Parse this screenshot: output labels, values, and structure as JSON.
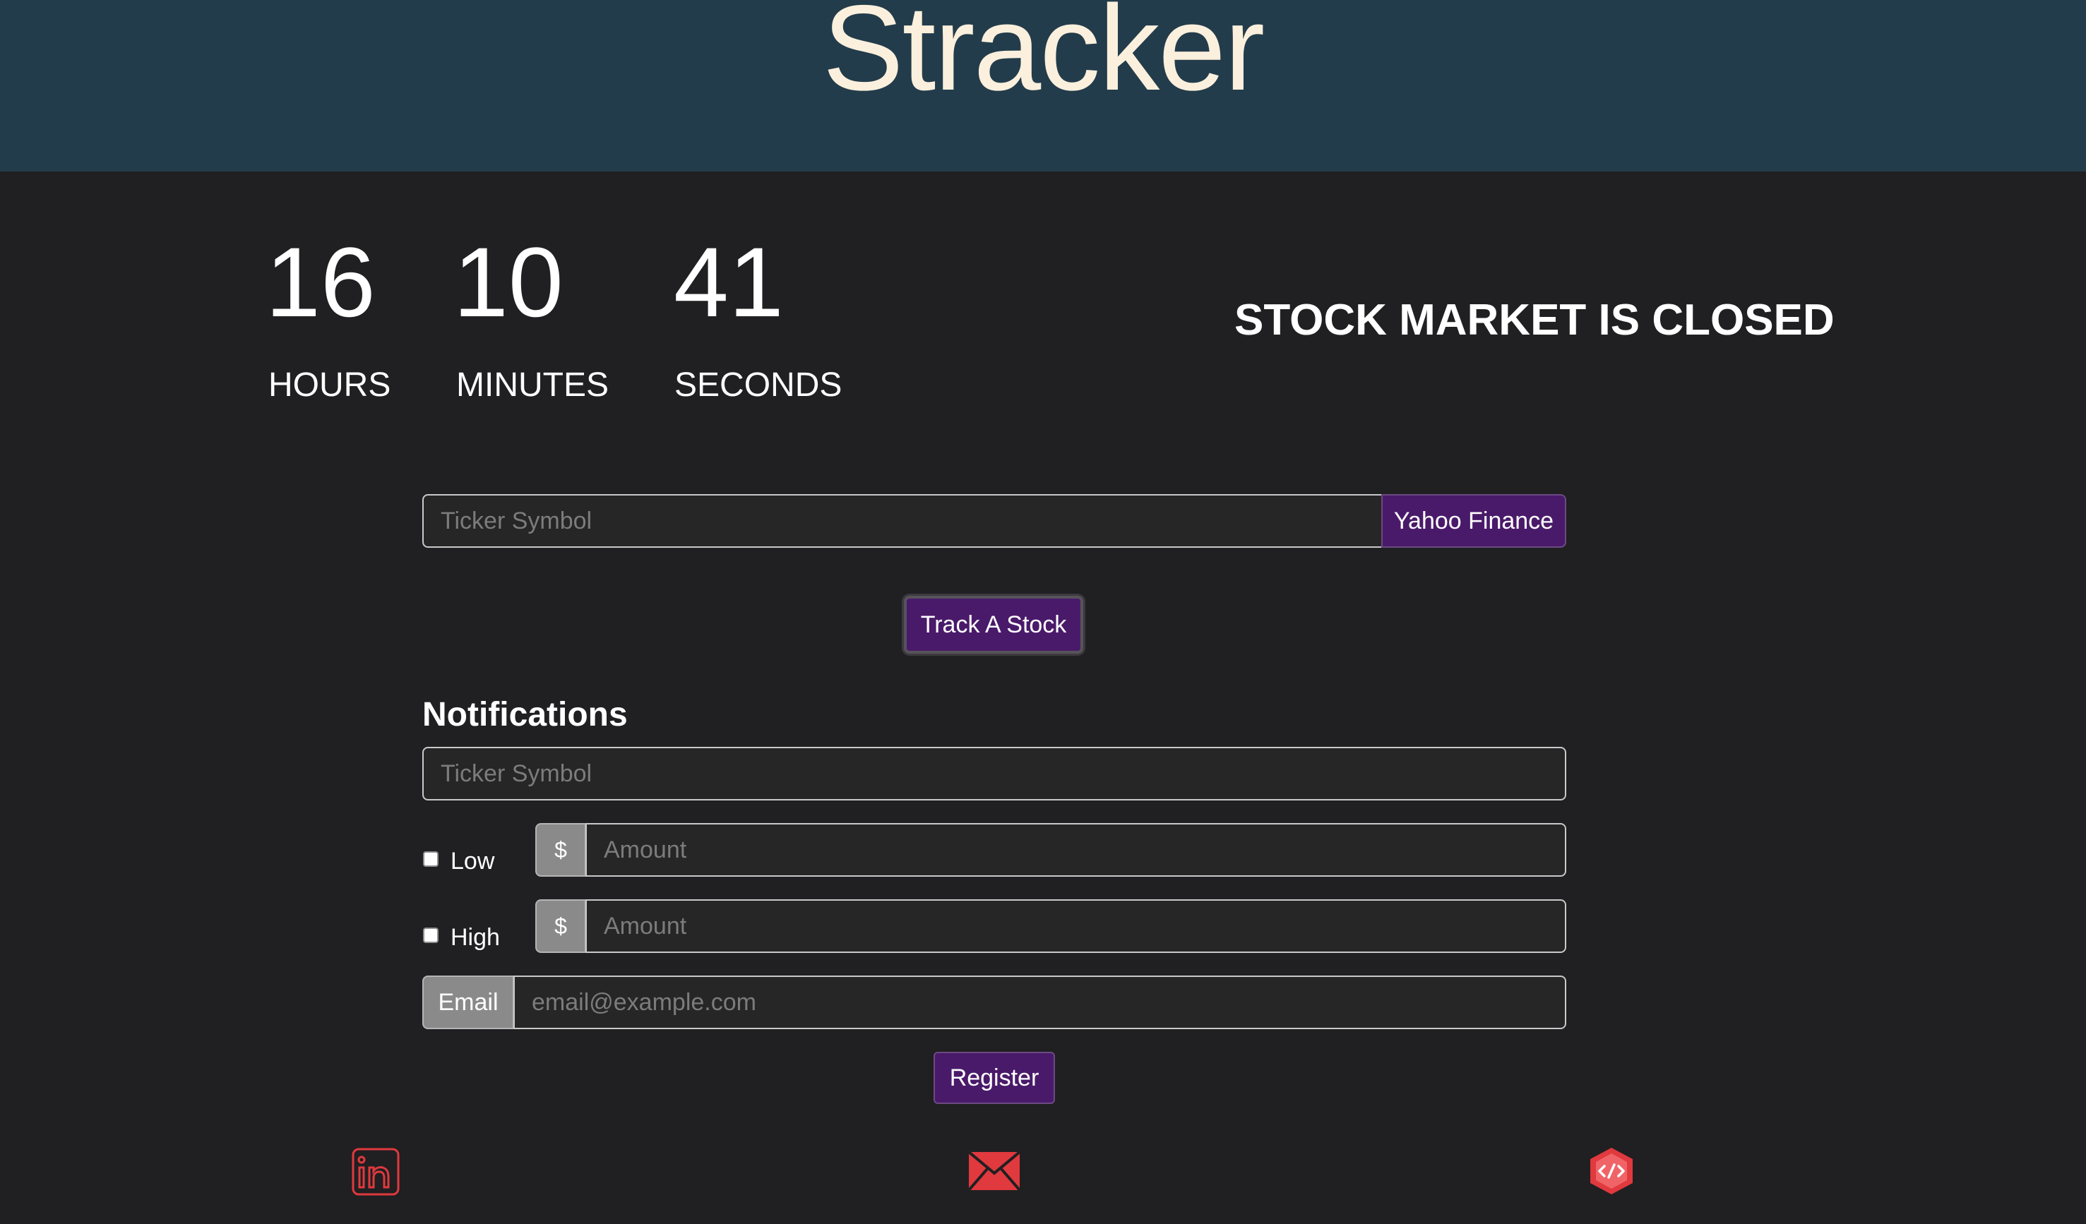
{
  "header": {
    "title": "Stracker"
  },
  "countdown": {
    "hours": {
      "value": "16",
      "label": "HOURS"
    },
    "minutes": {
      "value": "10",
      "label": "MINUTES"
    },
    "seconds": {
      "value": "41",
      "label": "SECONDS"
    }
  },
  "market_status": "STOCK MARKET IS CLOSED",
  "search": {
    "ticker_placeholder": "Ticker Symbol",
    "yahoo_button": "Yahoo Finance",
    "track_button": "Track A Stock"
  },
  "notifications": {
    "title": "Notifications",
    "ticker_placeholder": "Ticker Symbol",
    "low": {
      "label": "Low",
      "prefix": "$",
      "placeholder": "Amount",
      "checked": false
    },
    "high": {
      "label": "High",
      "prefix": "$",
      "placeholder": "Amount",
      "checked": false
    },
    "email": {
      "label": "Email",
      "placeholder": "email@example.com"
    },
    "register_button": "Register"
  },
  "footer": {
    "icons": [
      "linkedin-icon",
      "mail-icon",
      "code-icon"
    ],
    "icon_color": "#e0393e"
  },
  "colors": {
    "header_bg": "#233c4b",
    "page_bg": "#201f21",
    "title": "#fbf0dd",
    "accent": "#4a1a6a"
  }
}
